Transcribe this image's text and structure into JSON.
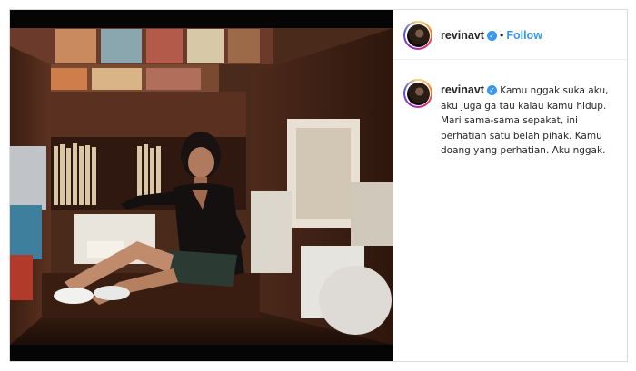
{
  "post": {
    "image_alt": "Woman sitting on the floor of a narrow record store aisle",
    "header": {
      "username": "revinavt",
      "separator": "•",
      "follow_label": "Follow"
    },
    "caption": {
      "username": "revinavt",
      "text": "Kamu nggak suka aku, aku juga ga tau kalau kamu hidup. Mari sama-sama sepakat, ini perhatian satu belah pihak. Kamu doang yang perhatian. Aku nggak."
    }
  },
  "colors": {
    "link_blue": "#3897f0",
    "text": "#262626",
    "border": "#dbdbdb"
  },
  "icons": {
    "verified": "verified-badge-icon"
  }
}
